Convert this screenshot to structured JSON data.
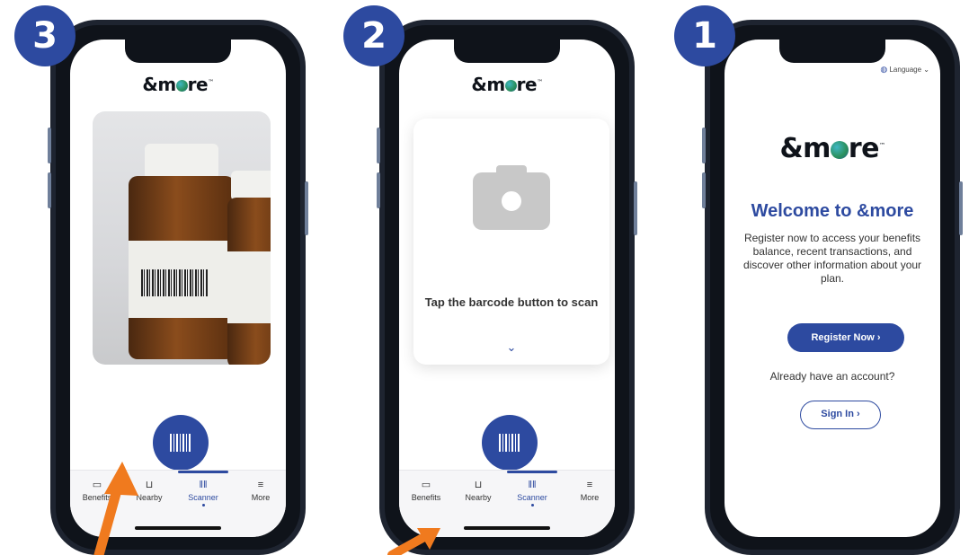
{
  "brand": {
    "logo_text_a": "&m",
    "logo_text_b": "re",
    "accent": "#2d4aa0",
    "arrow_color": "#f07a1e"
  },
  "screens": [
    {
      "step": "3",
      "photo_subject": "amber medicine bottles with barcode label",
      "scan_button_icon": "barcode-icon",
      "tabs": [
        {
          "label": "Benefits",
          "icon": "wallet-icon"
        },
        {
          "label": "Nearby",
          "icon": "cart-icon"
        },
        {
          "label": "Scanner",
          "icon": "barcode-icon"
        },
        {
          "label": "More",
          "icon": "menu-icon"
        }
      ]
    },
    {
      "step": "2",
      "card_text": "Tap the barcode button to scan",
      "chevron": "⌄",
      "scan_button_icon": "barcode-icon",
      "tabs": [
        {
          "label": "Benefits",
          "icon": "wallet-icon"
        },
        {
          "label": "Nearby",
          "icon": "cart-icon"
        },
        {
          "label": "Scanner",
          "icon": "barcode-icon"
        },
        {
          "label": "More",
          "icon": "menu-icon"
        }
      ]
    },
    {
      "step": "1",
      "language_label": "Language",
      "welcome_title": "Welcome to &more",
      "intro": "Register now to access your benefits balance, recent transactions, and discover other information about your plan.",
      "register_button": "Register Now ›",
      "already_text": "Already have an account?",
      "signin_button": "Sign In ›"
    }
  ]
}
